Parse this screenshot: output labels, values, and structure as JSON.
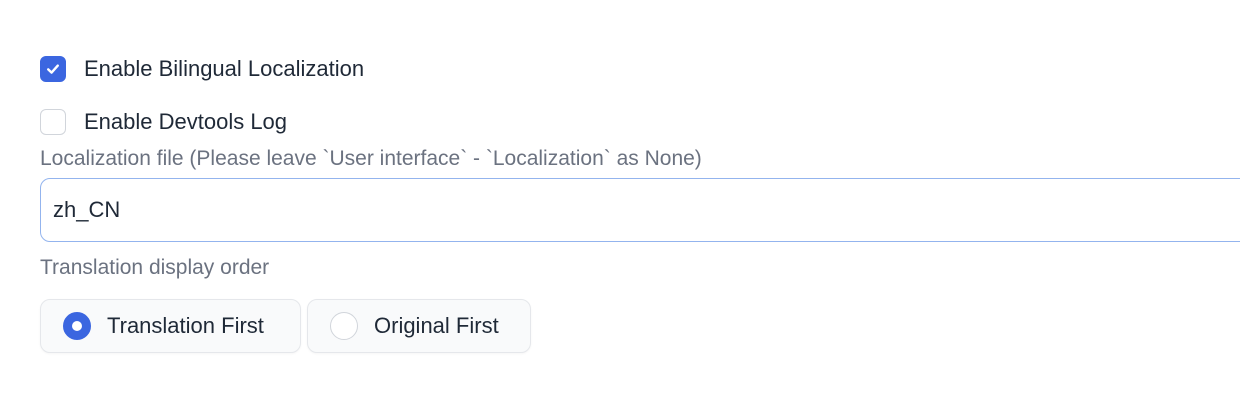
{
  "settings": {
    "bilingual": {
      "label": "Enable Bilingual Localization",
      "checked": true
    },
    "devtools_log": {
      "label": "Enable Devtools Log",
      "checked": false
    },
    "localization_file": {
      "label": "Localization file (Please leave `User interface` - `Localization` as None)",
      "value": "zh_CN"
    },
    "display_order": {
      "label": "Translation display order",
      "options": [
        {
          "label": "Translation First",
          "selected": true
        },
        {
          "label": "Original First",
          "selected": false
        }
      ]
    }
  },
  "colors": {
    "accent": "#3b66e0",
    "input_border": "#93b4ee",
    "muted_text": "#6b7280"
  },
  "icons": {
    "checkbox_checked": "check-icon"
  }
}
